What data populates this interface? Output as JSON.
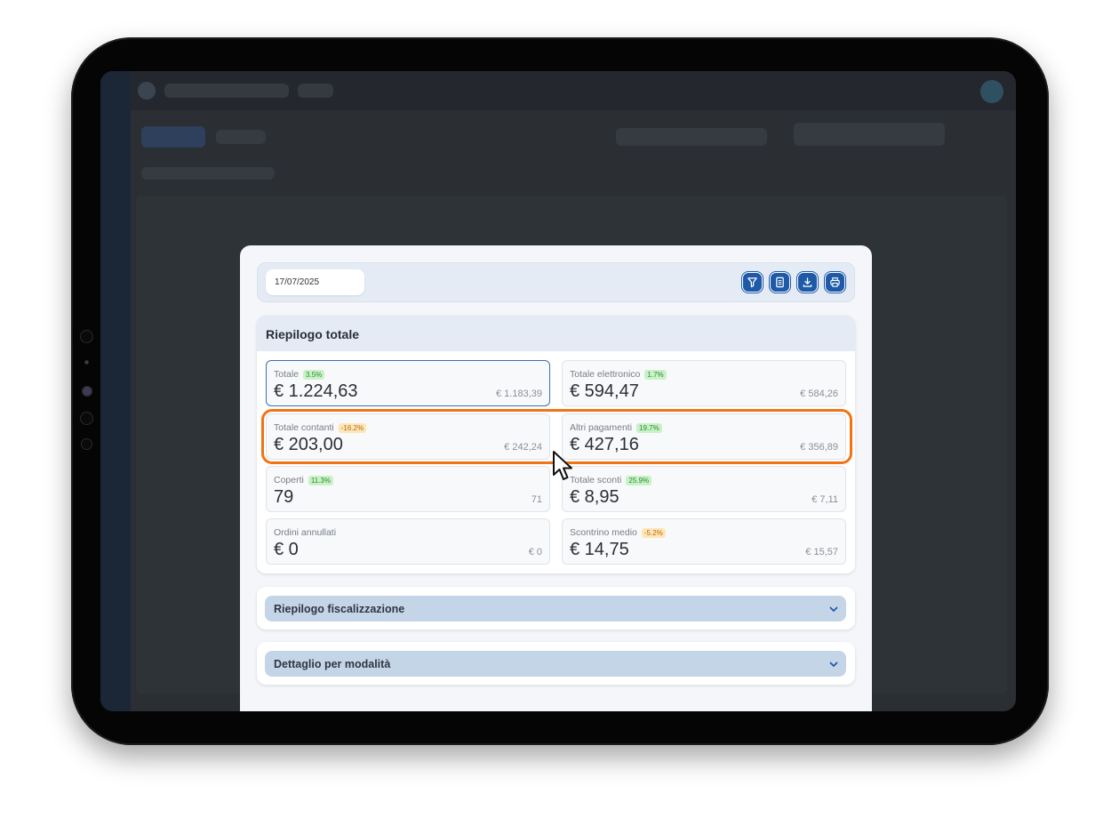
{
  "toolbar": {
    "date_value": "17/07/2025",
    "buttons": [
      {
        "name": "filter-button",
        "icon": "filter-icon"
      },
      {
        "name": "report-button",
        "icon": "document-icon"
      },
      {
        "name": "download-button",
        "icon": "download-icon"
      },
      {
        "name": "print-button",
        "icon": "print-icon"
      }
    ]
  },
  "summary": {
    "title": "Riepilogo totale",
    "stats": [
      {
        "label": "Totale",
        "badge": "3.5%",
        "trend": "up",
        "value": "€ 1.224,63",
        "previous": "€ 1.183,39",
        "selected": true
      },
      {
        "label": "Totale elettronico",
        "badge": "1.7%",
        "trend": "up",
        "value": "€ 594,47",
        "previous": "€ 584,26"
      },
      {
        "label": "Totale contanti",
        "badge": "-16.2%",
        "trend": "down",
        "value": "€ 203,00",
        "previous": "€ 242,24"
      },
      {
        "label": "Altri pagamenti",
        "badge": "19.7%",
        "trend": "up",
        "value": "€ 427,16",
        "previous": "€ 356,89"
      },
      {
        "label": "Coperti",
        "badge": "11.3%",
        "trend": "up",
        "value": "79",
        "previous": "71"
      },
      {
        "label": "Totale sconti",
        "badge": "25.9%",
        "trend": "up",
        "value": "€ 8,95",
        "previous": "€ 7,11"
      },
      {
        "label": "Ordini annullati",
        "badge": "",
        "trend": "",
        "value": "€ 0",
        "previous": "€ 0"
      },
      {
        "label": "Scontrino medio",
        "badge": "-5.2%",
        "trend": "down",
        "value": "€ 14,75",
        "previous": "€ 15,57"
      }
    ]
  },
  "accordions": [
    {
      "label": "Riepilogo fiscalizzazione"
    },
    {
      "label": "Dettaglio per modalità"
    }
  ],
  "colors": {
    "accent": "#1e5aa8",
    "highlight": "#f07414",
    "badge_up": "#c9f2c9",
    "badge_down": "#ffe6b8"
  }
}
